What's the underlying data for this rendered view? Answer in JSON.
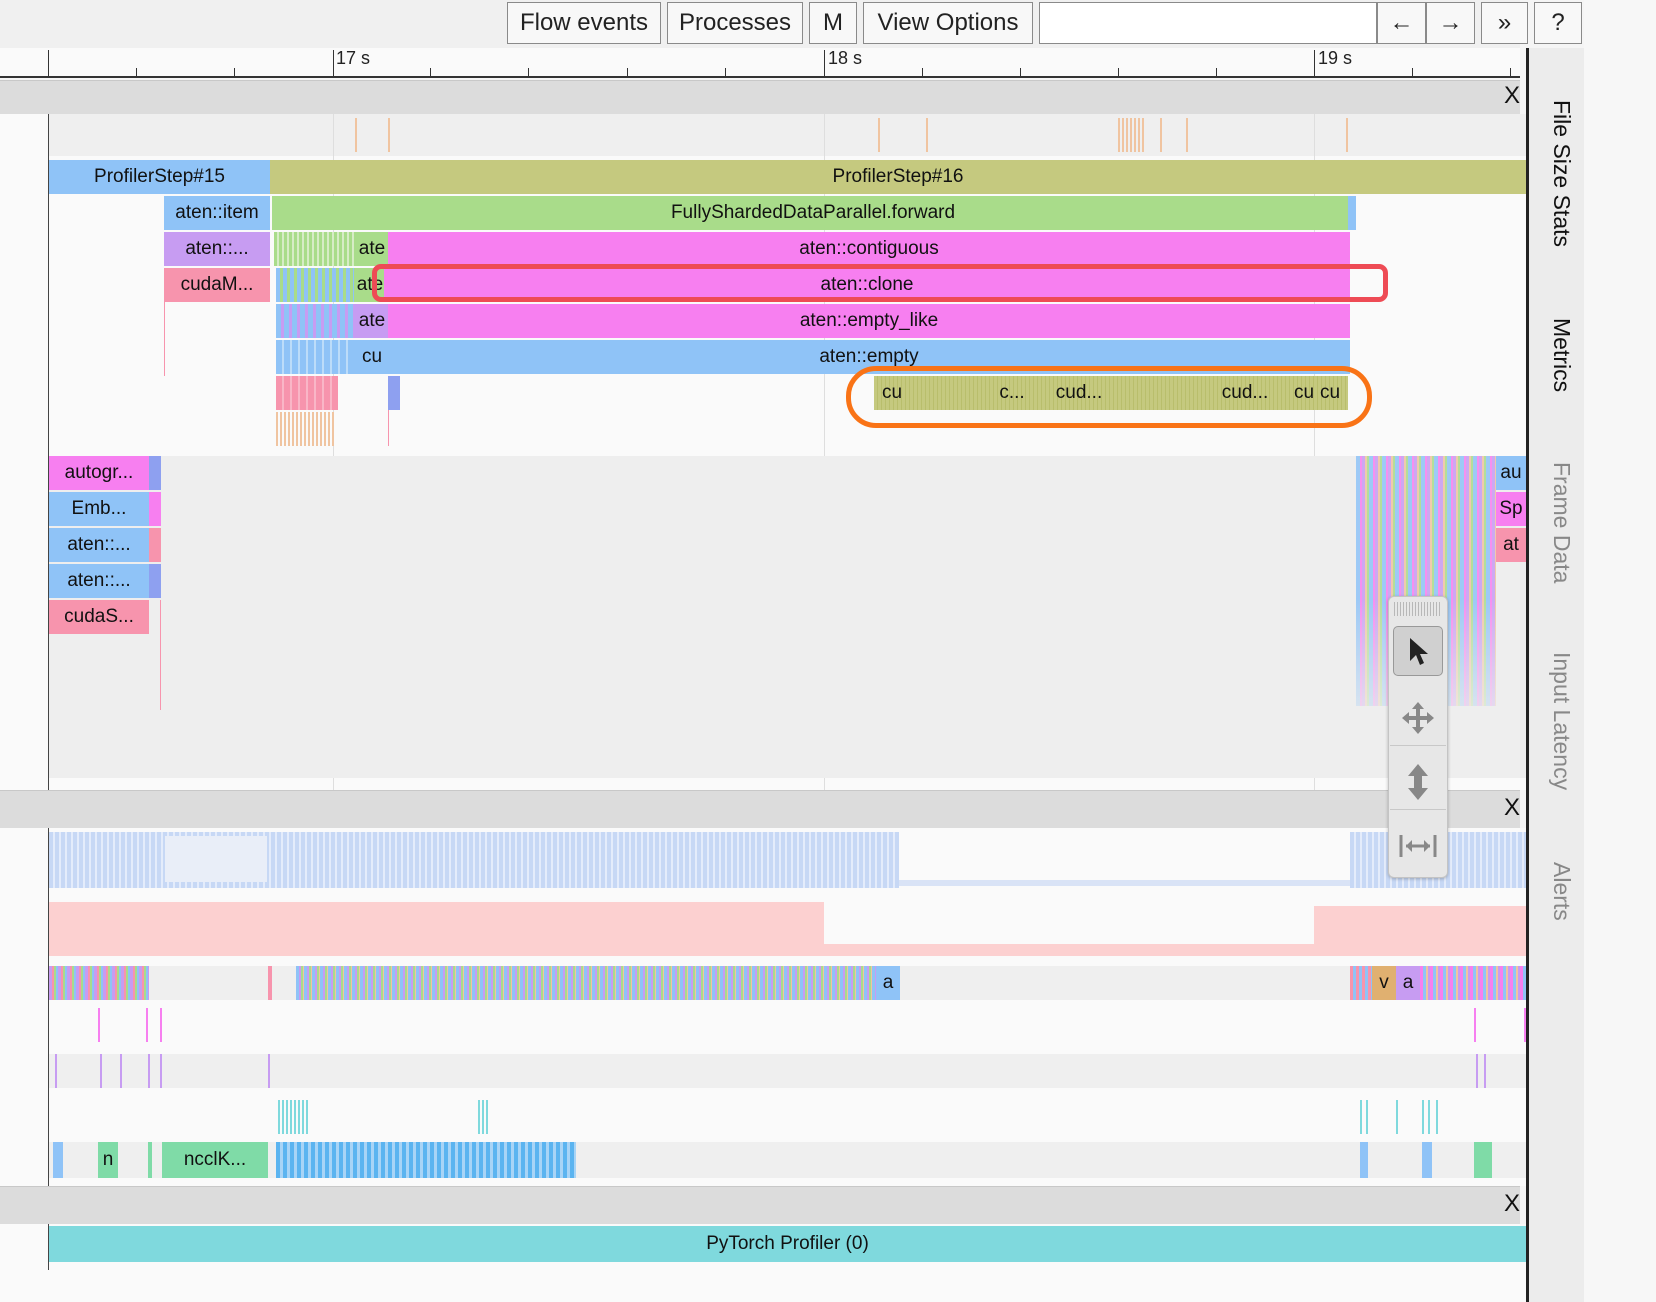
{
  "toolbar": {
    "flow_events": "Flow events",
    "processes": "Processes",
    "m": "M",
    "view_options": "View Options",
    "search_value": "",
    "prev": "←",
    "next": "→",
    "more": "»",
    "help": "?"
  },
  "ruler": {
    "labels": [
      "17 s",
      "18 s",
      "19 s"
    ]
  },
  "section_close": "X",
  "side_tabs": [
    "File Size Stats",
    "Metrics",
    "Frame Data",
    "Input Latency",
    "Alerts"
  ],
  "slices": {
    "step15": "ProfilerStep#15",
    "step16": "ProfilerStep#16",
    "item": "aten::item",
    "fsdp_forward": "FullyShardedDataParallel.forward",
    "aten_trunc": "aten::...",
    "ate1": "ate",
    "contiguous": "aten::contiguous",
    "cudam": "cudaM...",
    "ate2": "ate",
    "clone": "aten::clone",
    "ate3": "ate",
    "empty_like": "aten::empty_like",
    "cu1": "cu",
    "empty": "aten::empty",
    "k_cu": "cu",
    "k_c": "c...",
    "k_cud1": "cud...",
    "k_cud2": "cud...",
    "k_cu2": "cu",
    "k_cu3": "cu"
  },
  "thread2": {
    "left": [
      "autogr...",
      "Emb...",
      "aten::...",
      "aten::...",
      "cudaS..."
    ],
    "right": [
      "au",
      "Sp",
      "at"
    ]
  },
  "gpu": {
    "a1": "a",
    "v": "v",
    "a2": "a",
    "n": "n",
    "nccl": "ncclK..."
  },
  "footer": {
    "label": "PyTorch Profiler (0)"
  },
  "colors": {
    "blue": "#8fc3f7",
    "olive": "#c5c97f",
    "green": "#a9dc8a",
    "magenta": "#f77ff0",
    "purple": "#c79cf2",
    "pink": "#f794ad",
    "teal": "#7fd9dd",
    "red_highlight": "#ee4b55",
    "orange_highlight": "#f97316"
  }
}
